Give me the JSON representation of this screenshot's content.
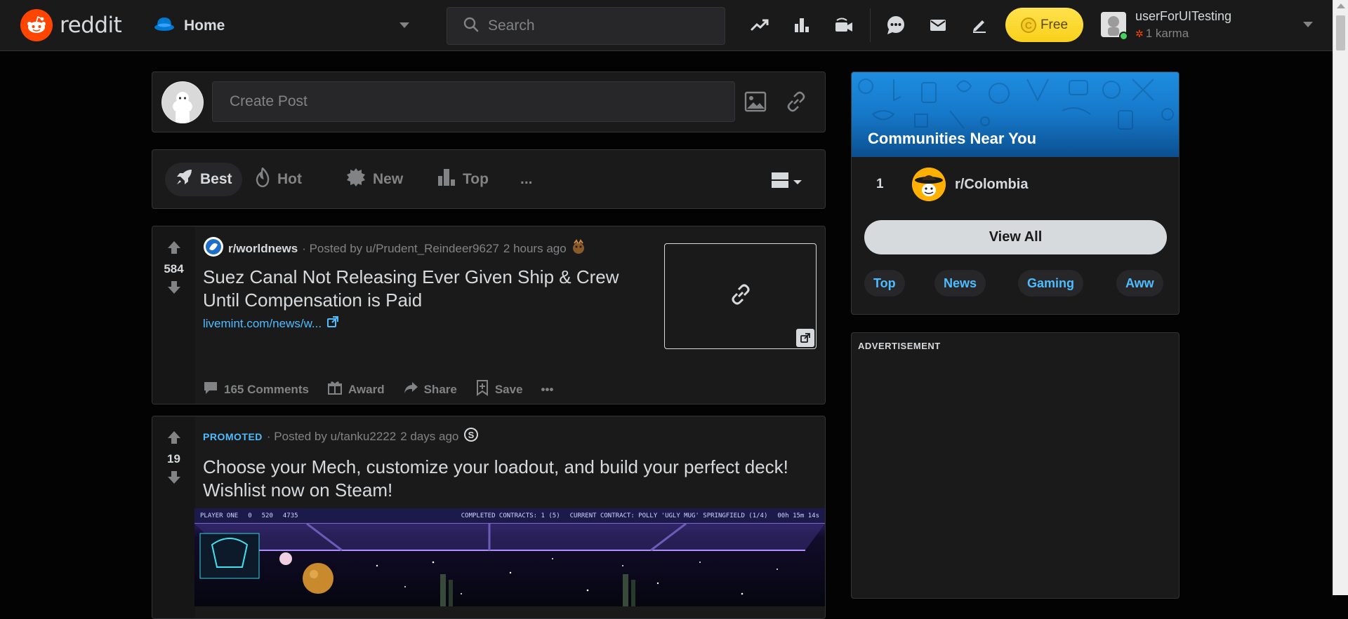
{
  "header": {
    "wordmark": "reddit",
    "home_label": "Home",
    "search_placeholder": "Search",
    "free_label": "Free",
    "username": "userForUITesting",
    "karma": "1 karma"
  },
  "create_post": {
    "placeholder": "Create Post"
  },
  "sort": {
    "best": "Best",
    "hot": "Hot",
    "new": "New",
    "top": "Top",
    "more": "..."
  },
  "posts": [
    {
      "votes": "584",
      "subreddit": "r/worldnews",
      "posted_by": "· Posted by u/Prudent_Reindeer9627",
      "time": "2 hours ago",
      "title": "Suez Canal Not Releasing Ever Given Ship & Crew Until Compensation is Paid",
      "link": "livemint.com/news/w...",
      "comments": "165 Comments",
      "award": "Award",
      "share": "Share",
      "save": "Save"
    },
    {
      "votes": "19",
      "promoted": "PROMOTED",
      "posted_by": "· Posted by u/tanku2222",
      "time": "2 days ago",
      "title": "Choose your Mech, customize your loadout, and build your perfect deck! Wishlist now on Steam!",
      "hud": {
        "player": "PLAYER ONE",
        "a": "0",
        "b": "520",
        "c": "4735",
        "completed": "COMPLETED CONTRACTS: 1 (5)",
        "current": "CURRENT CONTRACT: POLLY 'UGLY MUG' SPRINGFIELD (1/4)",
        "timer": "00h 15m 14s"
      }
    }
  ],
  "communities": {
    "title": "Communities Near You",
    "items": [
      {
        "rank": "1",
        "name": "r/Colombia"
      }
    ],
    "view_all": "View All",
    "tags": [
      "Top",
      "News",
      "Gaming",
      "Aww"
    ]
  },
  "ad": {
    "label": "ADVERTISEMENT"
  },
  "colors": {
    "brand": "#ff4500",
    "link": "#4fbcff",
    "background": "#030303",
    "card": "#1a1a1b"
  }
}
